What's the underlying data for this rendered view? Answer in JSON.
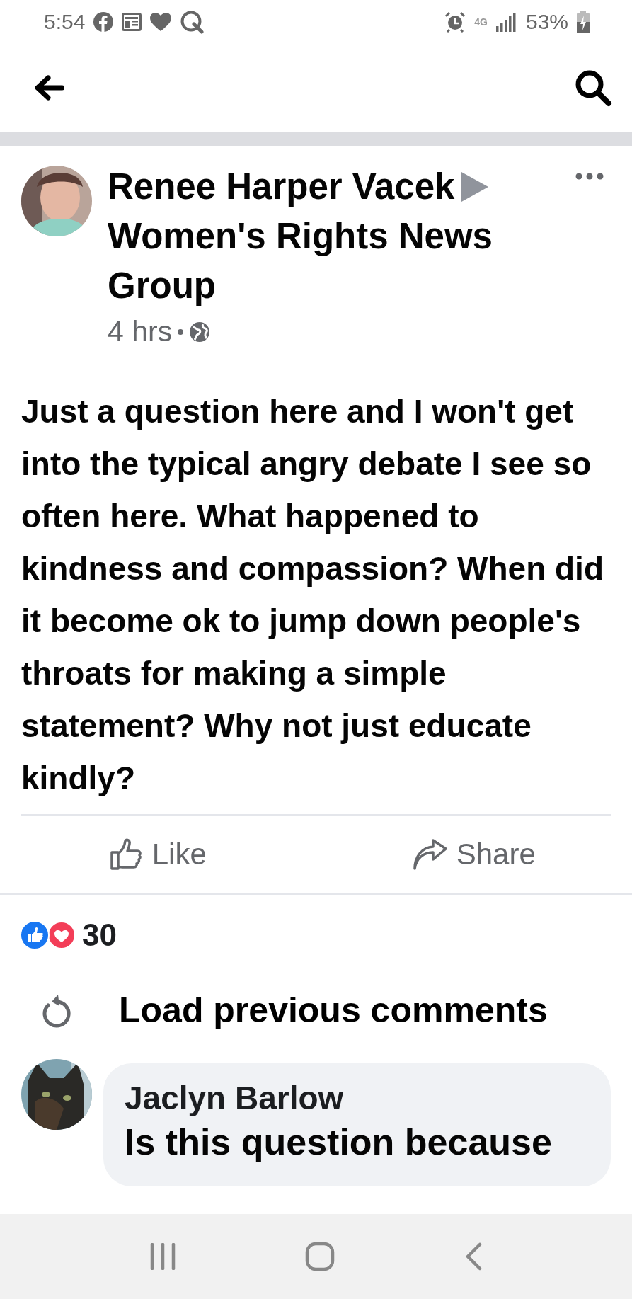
{
  "status_bar": {
    "time": "5:54",
    "network": "4G",
    "battery": "53%"
  },
  "post": {
    "author": "Renee Harper Vacek",
    "group": "Women's Rights News Group",
    "time": "4 hrs",
    "text": "Just a question here and I won't get into the typical angry debate I see so often here. What happened to kindness and compassion? When did it become ok to jump down people's throats for making a simple statement? Why not just educate kindly?",
    "actions": [
      {
        "kind": "like",
        "label": "Like"
      },
      {
        "kind": "share",
        "label": "Share"
      }
    ]
  },
  "reactions": {
    "count": "30"
  },
  "load_previous": "Load previous comments",
  "comments": [
    {
      "author": "Jaclyn Barlow",
      "text": "Is this question because"
    }
  ]
}
